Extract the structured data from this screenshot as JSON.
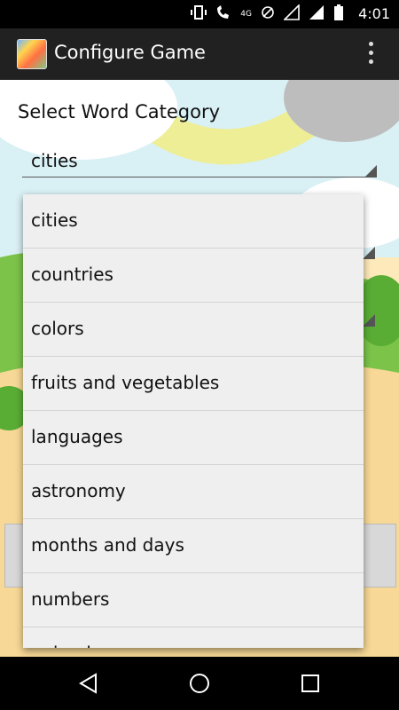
{
  "status_bar": {
    "time": "4:01",
    "network_label": "4G",
    "icons": [
      "vibrate-icon",
      "phone-wifi-icon",
      "no-sim-icon",
      "signal-icon",
      "signal-icon",
      "battery-icon"
    ]
  },
  "app_bar": {
    "title": "Configure Game",
    "icon": "app-logo-icon",
    "overflow_icon": "overflow-menu-icon"
  },
  "form": {
    "category_label": "Select Word Category",
    "category_value": "cities"
  },
  "dropdown": {
    "options": [
      {
        "label": "cities"
      },
      {
        "label": "countries"
      },
      {
        "label": "colors"
      },
      {
        "label": "fruits and vegetables"
      },
      {
        "label": "languages"
      },
      {
        "label": "astronomy"
      },
      {
        "label": "months and days"
      },
      {
        "label": "numbers"
      },
      {
        "label": "animals"
      }
    ]
  },
  "nav_bar": {
    "icons": [
      "back-icon",
      "home-icon",
      "recents-icon"
    ]
  },
  "colors": {
    "sky": "#fde9b9",
    "grass": "#7cc34a",
    "cloud": "#ffffff",
    "appbar": "#212121",
    "popup": "#efefef"
  }
}
